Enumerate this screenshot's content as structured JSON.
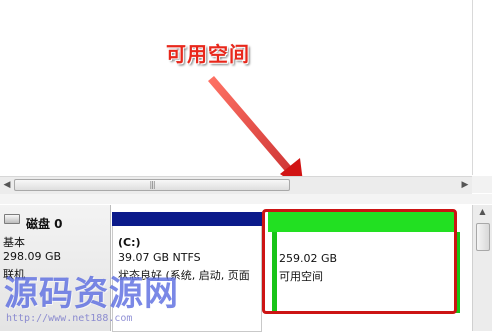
{
  "annotation": {
    "label": "可用空间",
    "color": "#e8271b"
  },
  "scrollbar": {
    "thumb_grip": "|||"
  },
  "disk": {
    "name": "磁盘 0",
    "type": "基本",
    "size": "298.09 GB",
    "status": "联机"
  },
  "partitions": [
    {
      "label": "(C:)",
      "size_fs": "39.07 GB NTFS",
      "status": "状态良好 (系统, 启动, 页面",
      "bar_color": "#0b1a8a"
    },
    {
      "size": "259.02 GB",
      "status": "可用空间",
      "bar_color": "#22e022",
      "highlight_color": "#cc1414"
    }
  ],
  "watermark": {
    "text": "源码资源网",
    "url": "http://www.net188.com"
  }
}
